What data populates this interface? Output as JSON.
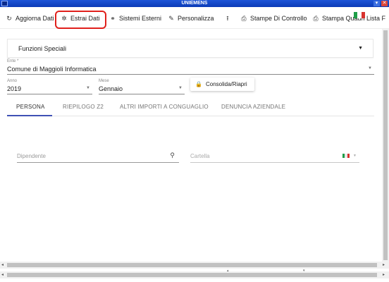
{
  "window": {
    "title": "UNIEMENS",
    "minimize_icon": "minimize-icon",
    "close_icon": "close-icon",
    "minimize_label": "▾",
    "close_label": "✕"
  },
  "toolbar": {
    "items": [
      {
        "label": "Aggiorna Dati",
        "icon": "refresh-icon",
        "glyph": "↻"
      },
      {
        "label": "Estrai Dati",
        "icon": "gear-icon",
        "glyph": "✲"
      },
      {
        "label": "Sistemi Esterni",
        "icon": "share-icon",
        "glyph": "⚭"
      },
      {
        "label": "Personalizza",
        "icon": "pencil-icon",
        "glyph": "✎"
      },
      {
        "label": "",
        "icon": "upload-icon",
        "glyph": "⭱"
      },
      {
        "label": "Stampe Di Controllo",
        "icon": "printer-icon",
        "glyph": "⎙"
      },
      {
        "label": "Stampa Quadri Lista F",
        "icon": "printer-icon",
        "glyph": "⎙"
      }
    ],
    "language_flag": "italian-flag-icon"
  },
  "special_functions": {
    "label": "Funzioni Speciali",
    "arrow": "▼"
  },
  "ente": {
    "label": "Ente *",
    "value": "Comune di Maggioli Informatica",
    "arrow": "▼"
  },
  "anno": {
    "label": "Anno",
    "value": "2019",
    "arrow": "▼"
  },
  "mese": {
    "label": "Mese",
    "value": "Gennaio",
    "arrow": "▼"
  },
  "consolida_button": {
    "label": "Consolida/Riapri",
    "icon": "lock-icon",
    "glyph": "🔒"
  },
  "tabs": [
    {
      "label": "PERSONA",
      "active": true
    },
    {
      "label": "RIEPILOGO Z2",
      "active": false
    },
    {
      "label": "ALTRI IMPORTI A CONGUAGLIO",
      "active": false
    },
    {
      "label": "DENUNCIA AZIENDALE",
      "active": false
    }
  ],
  "dipendente": {
    "placeholder": "Dipendente",
    "icon": "search-icon",
    "glyph": "⚲"
  },
  "cartella": {
    "placeholder": "Cartella",
    "arrow": "▼"
  },
  "colors": {
    "titlebar": "#1d55d8",
    "accent": "#3f51b5",
    "highlight": "#e0201c",
    "flag_green": "#1e9e48",
    "flag_white": "#ffffff",
    "flag_red": "#d8322f"
  },
  "scrollbars": {
    "left_arrow": "◂",
    "right_arrow": "▸",
    "up_arrow": "▴",
    "down_arrow": "▾"
  }
}
